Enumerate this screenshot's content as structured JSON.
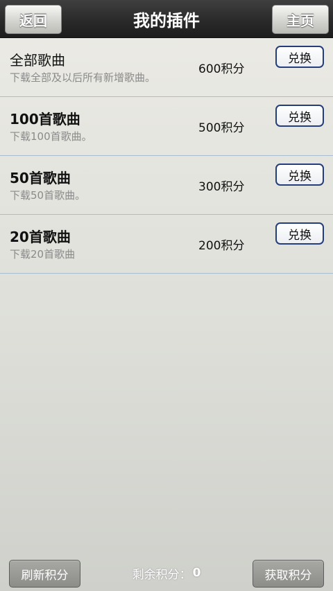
{
  "header": {
    "back_label": "返回",
    "title": "我的插件",
    "home_label": "主页"
  },
  "items": [
    {
      "title": "全部歌曲",
      "desc": "下载全部及以后所有新增歌曲。",
      "points": "600积分",
      "action": "兑换"
    },
    {
      "title": "100首歌曲",
      "desc": "下载100首歌曲。",
      "points": "500积分",
      "action": "兑换"
    },
    {
      "title": "50首歌曲",
      "desc": "下载50首歌曲。",
      "points": "300积分",
      "action": "兑换"
    },
    {
      "title": "20首歌曲",
      "desc": "下载20首歌曲",
      "points": "200积分",
      "action": "兑换"
    }
  ],
  "footer": {
    "refresh_label": "刷新积分",
    "remaining_label": "剩余积分：",
    "remaining_value": "0",
    "get_label": "获取积分"
  }
}
